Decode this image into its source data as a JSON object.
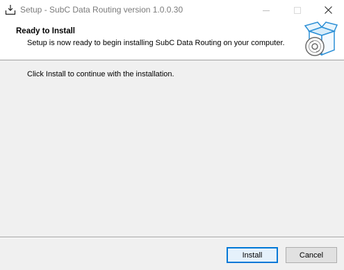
{
  "window": {
    "title": "Setup - SubC Data Routing version 1.0.0.30"
  },
  "header": {
    "title": "Ready to Install",
    "subtitle": "Setup is now ready to begin installing SubC Data Routing on your computer.",
    "image_icon": "install-box-cd-icon"
  },
  "body": {
    "instruction": "Click Install to continue with the installation."
  },
  "buttons": {
    "install_label": "Install",
    "cancel_label": "Cancel"
  },
  "colors": {
    "accent": "#0078d7",
    "window_bg": "#f0f0f0",
    "header_bg": "#ffffff"
  }
}
